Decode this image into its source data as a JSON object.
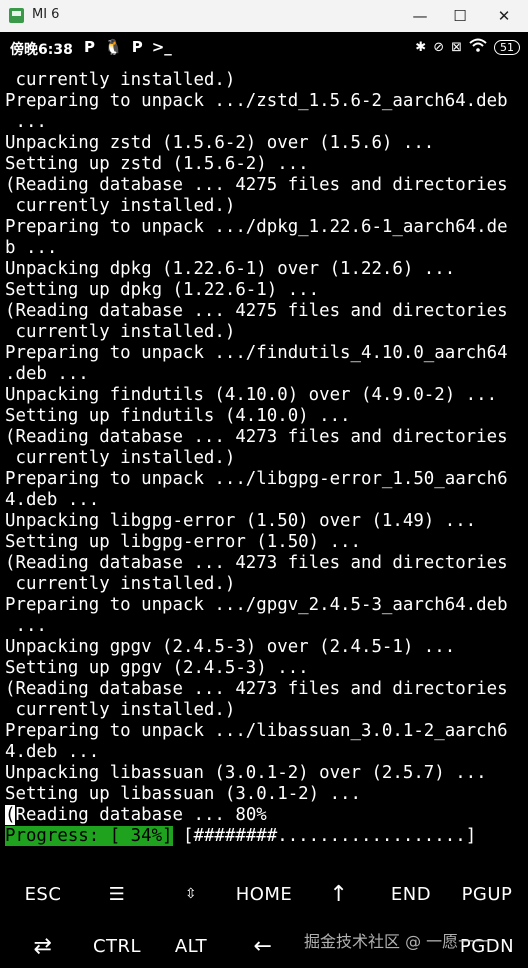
{
  "window": {
    "title": "MI 6",
    "minimize_glyph": "—",
    "maximize_glyph": "☐",
    "close_glyph": "✕"
  },
  "statusbar": {
    "time": "傍晚6:38",
    "left_icons": [
      "P",
      "🐧",
      "P",
      ">_"
    ],
    "right_icons": [
      "✱",
      "⊘",
      "⊠",
      "wifi"
    ],
    "battery": "51"
  },
  "terminal": {
    "lines": [
      " currently installed.)",
      "Preparing to unpack .../zstd_1.5.6-2_aarch64.deb",
      " ...",
      "Unpacking zstd (1.5.6-2) over (1.5.6) ...",
      "Setting up zstd (1.5.6-2) ...",
      "(Reading database ... 4275 files and directories",
      " currently installed.)",
      "Preparing to unpack .../dpkg_1.22.6-1_aarch64.de",
      "b ...",
      "Unpacking dpkg (1.22.6-1) over (1.22.6) ...",
      "Setting up dpkg (1.22.6-1) ...",
      "(Reading database ... 4275 files and directories",
      " currently installed.)",
      "Preparing to unpack .../findutils_4.10.0_aarch64",
      ".deb ...",
      "Unpacking findutils (4.10.0) over (4.9.0-2) ...",
      "Setting up findutils (4.10.0) ...",
      "(Reading database ... 4273 files and directories",
      " currently installed.)",
      "Preparing to unpack .../libgpg-error_1.50_aarch6",
      "4.deb ...",
      "Unpacking libgpg-error (1.50) over (1.49) ...",
      "Setting up libgpg-error (1.50) ...",
      "(Reading database ... 4273 files and directories",
      " currently installed.)",
      "Preparing to unpack .../gpgv_2.4.5-3_aarch64.deb",
      " ...",
      "Unpacking gpgv (2.4.5-3) over (2.4.5-1) ...",
      "Setting up gpgv (2.4.5-3) ...",
      "(Reading database ... 4273 files and directories",
      " currently installed.)",
      "Preparing to unpack .../libassuan_3.0.1-2_aarch6",
      "4.deb ...",
      "Unpacking libassuan (3.0.1-2) over (2.5.7) ...",
      "Setting up libassuan (3.0.1-2) ..."
    ],
    "cursor_char": "(",
    "current_line_rest": "Reading database ... 80%",
    "progress_label": "Progress: [ 34%]",
    "progress_rest": " [########..................]",
    "progress_percent": 34
  },
  "extra_keys": {
    "row1": [
      "ESC",
      "☰",
      "⇳",
      "HOME",
      "↑",
      "END",
      "PGUP"
    ],
    "row2": [
      "⇄",
      "CTRL",
      "ALT",
      "←",
      "↓",
      "→",
      "PGDN"
    ]
  },
  "watermark": "掘金技术社区 @ 一愿一一"
}
